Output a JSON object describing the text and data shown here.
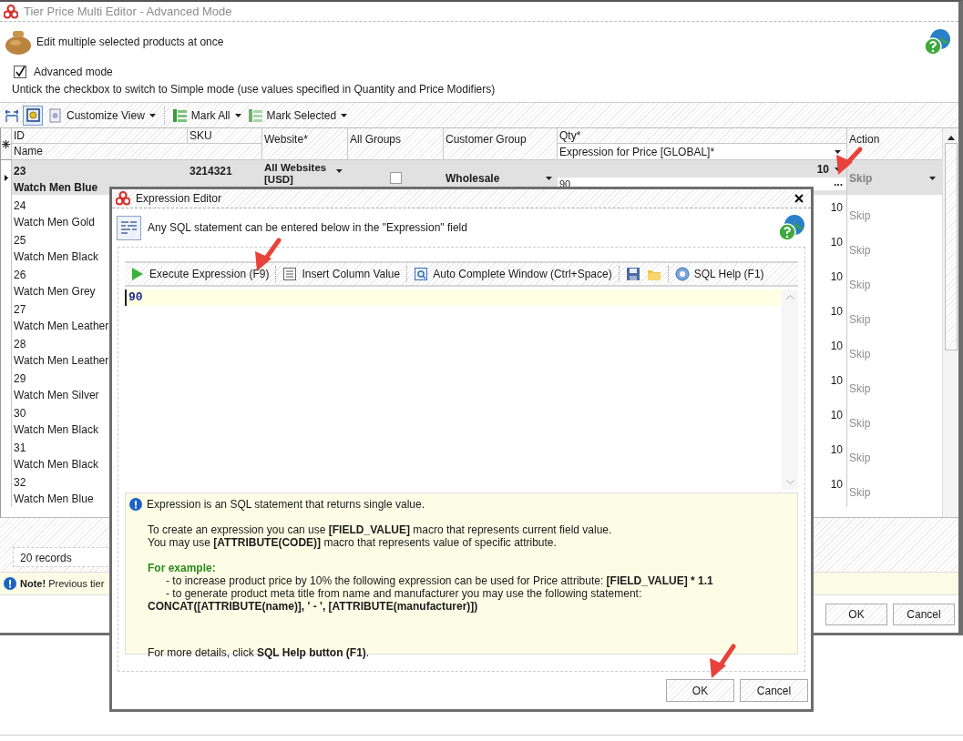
{
  "window": {
    "title": "Tier Price Multi Editor - Advanced Mode"
  },
  "header": {
    "text": "Edit multiple selected products at once"
  },
  "advanced_mode": {
    "label": "Advanced mode",
    "checked": true
  },
  "hint": "Untick the checkbox to switch to Simple mode (use values specified in Quantity and Price Modifiers)",
  "toolbar": {
    "toggle_on": true,
    "items": [
      {
        "label": "Customize View"
      },
      {
        "label": "Mark All"
      },
      {
        "label": "Mark Selected"
      }
    ]
  },
  "grid": {
    "columns": [
      "ID",
      "SKU",
      "Website*",
      "All Groups",
      "Customer Group",
      "Qty*",
      "Action",
      "Name",
      "Expression for Price [GLOBAL]*"
    ],
    "rows": [
      {
        "id": "23",
        "name": "Watch Men Blue",
        "sku": "3214321",
        "website": "All Websites [USD]",
        "all_groups": false,
        "customer_group": "Wholesale",
        "qty": "10",
        "expression": "90",
        "editor_button": "...",
        "action": "Skip",
        "selected": true
      },
      {
        "id": "24",
        "name": "Watch Men Gold",
        "qty": "10",
        "action": "Skip",
        "selected": false
      },
      {
        "id": "25",
        "name": "Watch Men Black",
        "qty": "10",
        "action": "Skip",
        "selected": false
      },
      {
        "id": "26",
        "name": "Watch Men Grey",
        "qty": "10",
        "action": "Skip",
        "selected": false
      },
      {
        "id": "27",
        "name": "Watch Men Leather",
        "qty": "10",
        "action": "Skip",
        "selected": false
      },
      {
        "id": "28",
        "name": "Watch Men Leather",
        "qty": "10",
        "action": "Skip",
        "selected": false
      },
      {
        "id": "29",
        "name": "Watch Men Silver",
        "qty": "10",
        "action": "Skip",
        "selected": false
      },
      {
        "id": "30",
        "name": "Watch Men Black",
        "qty": "10",
        "action": "Skip",
        "selected": false
      },
      {
        "id": "31",
        "name": "Watch Men Black",
        "qty": "10",
        "action": "Skip",
        "selected": false
      },
      {
        "id": "32",
        "name": "Watch Men Blue",
        "qty": "10",
        "action": "Skip",
        "selected": false
      }
    ]
  },
  "records": "20 records",
  "note": "**Note!** Previous tier",
  "buttons": [
    "OK",
    "Cancel"
  ],
  "dialog": {
    "title": "Expression Editor",
    "description": "Any SQL statement can be entered below in the \"Expression\" field",
    "toolbar": [
      {
        "kind": "execute",
        "label": "Execute Expression (F9)"
      },
      {
        "kind": "insert",
        "label": "Insert Column Value"
      },
      {
        "kind": "autocomplete",
        "label": "Auto Complete Window (Ctrl+Space)"
      },
      {
        "kind": "save"
      },
      {
        "kind": "open"
      },
      {
        "kind": "help",
        "label": "SQL Help (F1)"
      }
    ],
    "expression": "90",
    "info": {
      "title": "Expression is an SQL statement that returns single value.",
      "lines": [
        {
          "kind": "text",
          "text": "To create an expression you can use **[FIELD_VALUE]** macro that represents current field value."
        },
        {
          "kind": "text",
          "text": "You may use **[ATTRIBUTE(CODE)]** macro that represents value of specific attribute."
        },
        {
          "kind": "heading",
          "text": "For example:"
        },
        {
          "kind": "bullet",
          "text": "- to increase product price by 10% the following expression can be used for Price attribute: **[FIELD_VALUE] * 1.1**"
        },
        {
          "kind": "bullet",
          "text": "- to generate product meta title from name and manufacturer you may use the following statement: **CONCAT([ATTRIBUTE(name)], ' - ', [ATTRIBUTE(manufacturer)])**"
        },
        {
          "kind": "footer",
          "text": "For more details, click **SQL Help button (F1)**."
        }
      ]
    },
    "buttons": [
      "OK",
      "Cancel"
    ]
  }
}
